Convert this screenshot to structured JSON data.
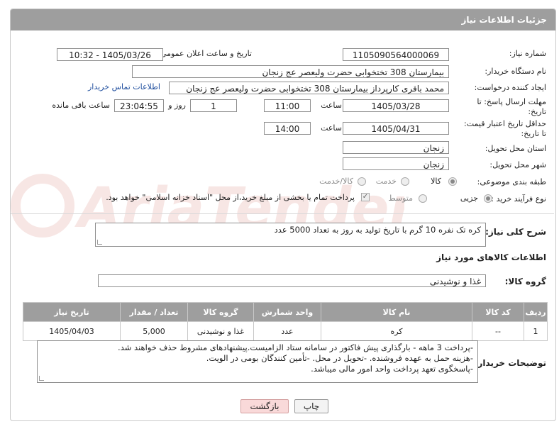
{
  "header": {
    "title": "جزئیات اطلاعات نیاز"
  },
  "need_number": {
    "label": "شماره نیاز:",
    "value": "1105090564000069"
  },
  "announce_datetime": {
    "label": "تاریخ و ساعت اعلان عمومی:",
    "value": "1405/03/26 - 10:32"
  },
  "buyer_org": {
    "label": "نام دستگاه خریدار:",
    "value": "بیمارستان 308 تختخوابی حضرت ولیعصر عج  زنجان"
  },
  "requester": {
    "label": "ایجاد کننده درخواست:",
    "value": "محمد باقری کارپرداز بیمارستان 308 تختخوابی حضرت ولیعصر عج  زنجان",
    "contact_link": "اطلاعات تماس خریدار"
  },
  "deadline": {
    "label_line1": "مهلت ارسال پاسخ: تا",
    "label_line2": "تاریخ:",
    "date": "1405/03/28",
    "time_label": "ساعت",
    "time": "11:00",
    "days": "1",
    "days_label": "روز و",
    "remaining": "23:04:55",
    "remaining_label": "ساعت باقی مانده"
  },
  "price_validity": {
    "label_line1": "حداقل تاریخ اعتبار قیمت:",
    "label_line2": "تا تاریخ:",
    "date": "1405/04/31",
    "time_label": "ساعت",
    "time": "14:00"
  },
  "delivery_province": {
    "label": "استان محل تحویل:",
    "value": "زنجان"
  },
  "delivery_city": {
    "label": "شهر محل تحویل:",
    "value": "زنجان"
  },
  "category": {
    "label": "طبقه بندی موضوعی:",
    "options": [
      "کالا",
      "خدمت",
      "کالا/خدمت"
    ],
    "selected": "کالا"
  },
  "process_type": {
    "label": "نوع فرآیند خرید :",
    "options": [
      "جزیی",
      "متوسط"
    ],
    "selected": "جزیی",
    "payment_note": "پرداخت تمام یا بخشی از مبلغ خرید،از محل \"اسناد خزانه اسلامی\" خواهد بود."
  },
  "description": {
    "label": "شرح کلی نیاز:",
    "value": "کره تک نفره 10 گرم با تاریخ تولید به روز به تعداد 5000 عدد"
  },
  "goods_info": {
    "title": "اطلاعات کالاهای مورد نیاز"
  },
  "goods_group": {
    "label": "گروه کالا:",
    "value": "غذا و نوشیدنی"
  },
  "table": {
    "headers": [
      "ردیف",
      "کد کالا",
      "نام کالا",
      "واحد شمارش",
      "گروه کالا",
      "تعداد / مقدار",
      "تاریخ نیاز"
    ],
    "rows": [
      [
        "1",
        "--",
        "کره",
        "عدد",
        "غذا و نوشیدنی",
        "5,000",
        "1405/04/03"
      ]
    ]
  },
  "buyer_notes": {
    "label": "توضیحات خریدار:",
    "lines": [
      "-پرداخت  3 ماهه - بارگذاری پیش فاکتور در سامانه ستاد الزامیست.پیشنهادهای مشروط حذف خواهند شد.",
      "-هزینه حمل به عهده فروشنده. -تحویل در محل. -تأمین کنندگان بومی در الویت.",
      "-پاسخگوی تعهد پرداخت واحد امور مالی میباشد."
    ]
  },
  "buttons": {
    "print": "چاپ",
    "back": "بازگشت"
  },
  "colors": {
    "header_bg": "#9e9e9e",
    "link": "#1f4e9e",
    "back_btn": "#f9d9d9"
  },
  "watermark": {
    "text": "AriaTender.net"
  }
}
